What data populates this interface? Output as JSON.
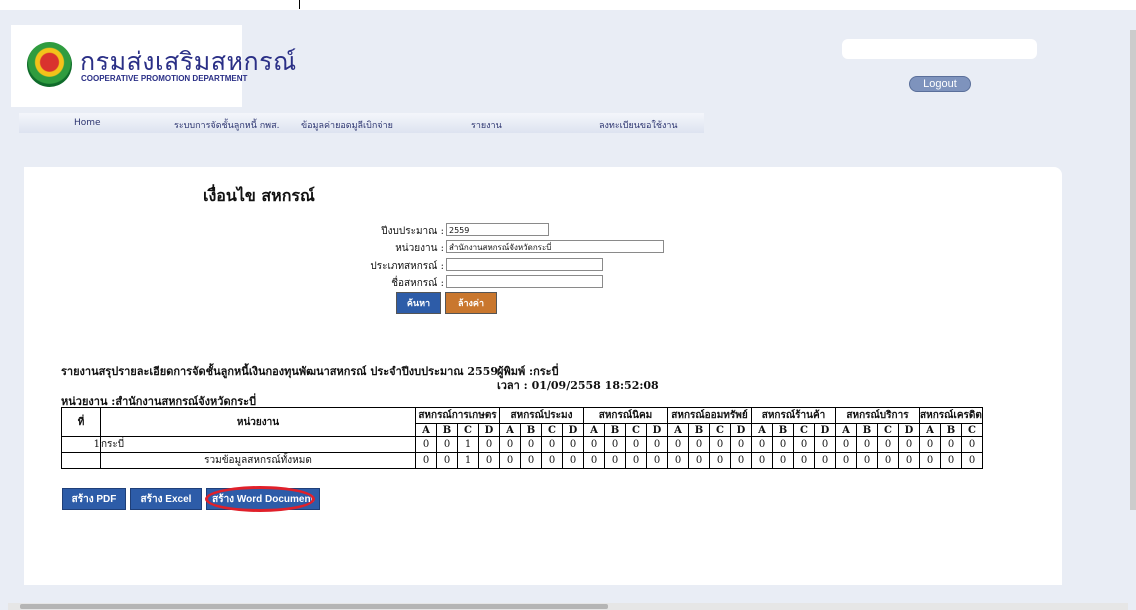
{
  "header": {
    "logo_thai": "กรมส่งเสริมสหกรณ์",
    "logo_english": "COOPERATIVE PROMOTION DEPARTMENT",
    "logout_label": "Logout"
  },
  "nav": {
    "items": [
      "Home",
      "ระบบการจัดชั้นลูกหนี้ กพส.",
      "ข้อมูลค่ายอดมูลีเบิกจ่าย",
      "รายงาน",
      "ลงทะเบียนขอใช้งาน"
    ]
  },
  "form": {
    "title": "เงื่อนไข สหกรณ์",
    "fields": [
      {
        "label": "ปีงบประมาณ :",
        "value": "2559"
      },
      {
        "label": "หน่วยงาน :",
        "value": "สำนักงานสหกรณ์จังหวัดกระบี่"
      },
      {
        "label": "ประเภทสหกรณ์ :",
        "value": ""
      },
      {
        "label": "ชื่อสหกรณ์ :",
        "value": ""
      }
    ],
    "search_label": "ค้นหา",
    "clear_label": "ล้างค่า"
  },
  "report": {
    "title": "รายงานสรุปรายละเอียดการจัดชั้นลูกหนี้เงินกองทุนพัฒนาสหกรณ์ ประจำปีงบประมาณ 2559",
    "printer": "ผู้พิมพ์ :กระบี่",
    "time": "เวลา : 01/09/2558 18:52:08",
    "unit": "หน่วยงาน :สำนักงานสหกรณ์จังหวัดกระบี่"
  },
  "table": {
    "col_no": "ที่",
    "col_unit": "หน่วยงาน",
    "groups": [
      "สหกรณ์การเกษตร",
      "สหกรณ์ประมง",
      "สหกรณ์นิคม",
      "สหกรณ์ออมทรัพย์",
      "สหกรณ์ร้านค้า",
      "สหกรณ์บริการ",
      "สหกรณ์เครดิตยูเ"
    ],
    "sub": [
      "A",
      "B",
      "C",
      "D"
    ],
    "rows": [
      {
        "no": "1",
        "name": "กระบี่",
        "values": [
          "0",
          "0",
          "1",
          "0",
          "0",
          "0",
          "0",
          "0",
          "0",
          "0",
          "0",
          "0",
          "0",
          "0",
          "0",
          "0",
          "0",
          "0",
          "0",
          "0",
          "0",
          "0",
          "0",
          "0",
          "0",
          "0",
          "0"
        ]
      },
      {
        "no": "",
        "name": "รวมข้อมูลสหกรณ์ทั้งหมด",
        "values": [
          "0",
          "0",
          "1",
          "0",
          "0",
          "0",
          "0",
          "0",
          "0",
          "0",
          "0",
          "0",
          "0",
          "0",
          "0",
          "0",
          "0",
          "0",
          "0",
          "0",
          "0",
          "0",
          "0",
          "0",
          "0",
          "0",
          "0"
        ]
      }
    ]
  },
  "export": {
    "pdf": "สร้าง PDF",
    "excel": "สร้าง Excel",
    "word": "สร้าง Word Document"
  },
  "colors": {
    "accent_blue": "#2d5ca8",
    "clear_orange": "#c9772e",
    "highlight_red": "#e0202a"
  }
}
